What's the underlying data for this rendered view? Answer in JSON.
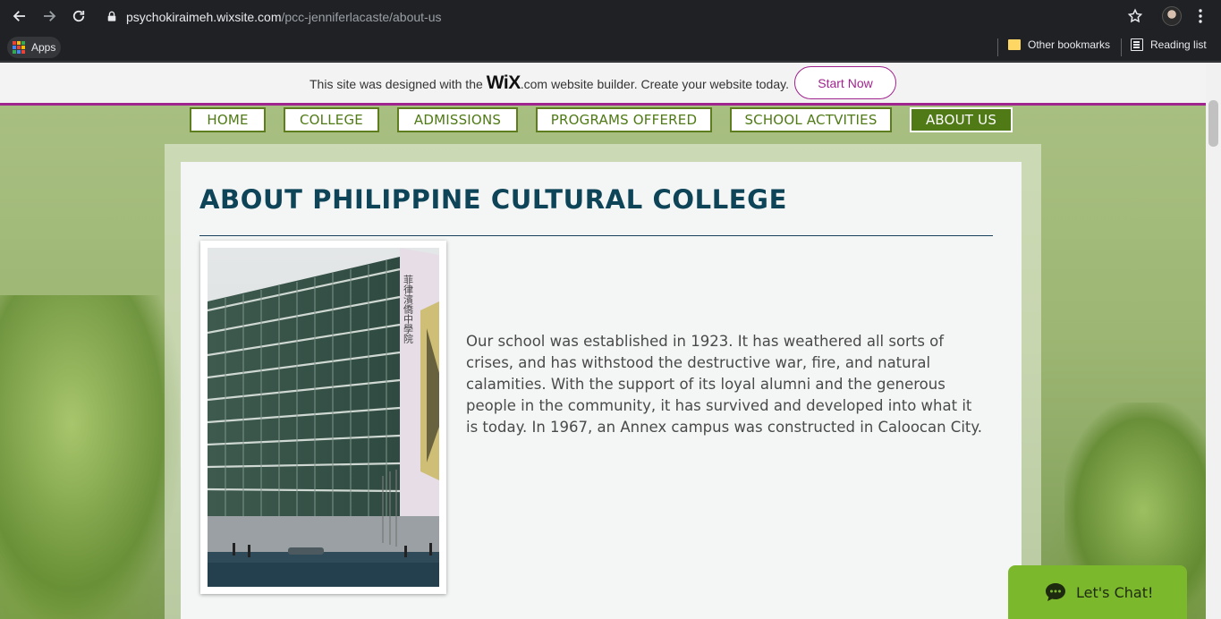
{
  "browser": {
    "url_host": "psychokiraimeh.wixsite.com",
    "url_path": "/pcc-jenniferlacaste/about-us",
    "bookmarks": {
      "apps_label": "Apps",
      "other_label": "Other bookmarks",
      "reading_label": "Reading list"
    }
  },
  "wix_banner": {
    "text_before": "This site was designed with the",
    "logo": "WiX",
    "domain": ".com",
    "text_after": "website builder. Create your website today.",
    "button": "Start Now"
  },
  "nav": {
    "items": [
      {
        "label": "HOME"
      },
      {
        "label": "COLLEGE"
      },
      {
        "label": "ADMISSIONS"
      },
      {
        "label": "PROGRAMS OFFERED"
      },
      {
        "label": "SCHOOL ACTVITIES"
      },
      {
        "label": "ABOUT US"
      }
    ],
    "active": "ABOUT US"
  },
  "main": {
    "title": "ABOUT PHILIPPINE CULTURAL COLLEGE",
    "paragraph": "Our school was established in 1923. It has weathered all sorts of crises, and has withstood the destructive war, fire, and natural calamities. With the support of its loyal alumni and the generous people in the community, it has survived and developed into what it is today. In 1967, an Annex campus was constructed in Caloocan City.",
    "photo_sign": "菲律濱僑中學院"
  },
  "chat": {
    "label": "Let's Chat!"
  },
  "colors": {
    "accent_green": "#4f7a16",
    "wix_purple": "#a0248e",
    "title_blue": "#0e4458",
    "chat_green": "#7cb82b"
  }
}
